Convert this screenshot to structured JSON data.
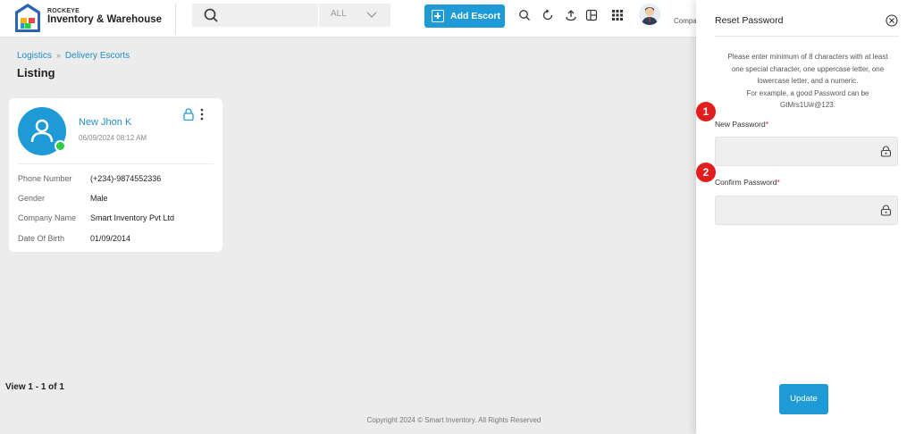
{
  "brand": {
    "small": "ROCKEYE",
    "name": "Inventory & Warehouse"
  },
  "search": {
    "placeholder": "",
    "filter_value": "ALL"
  },
  "header": {
    "add_button_label": "Add Escort",
    "company_text": "Compa"
  },
  "breadcrumb": {
    "items": [
      "Logistics",
      "Delivery Escorts"
    ]
  },
  "page": {
    "title": "Listing"
  },
  "card": {
    "name": "New Jhon K",
    "datetime": "06/09/2024 08:12 AM",
    "fields": [
      {
        "label": "Phone Number",
        "value": "(+234)-9874552336"
      },
      {
        "label": "Gender",
        "value": "Male"
      },
      {
        "label": "Company Name",
        "value": "Smart Inventory Pvt Ltd"
      },
      {
        "label": "Date Of Birth",
        "value": "01/09/2014"
      }
    ]
  },
  "pagination": {
    "view_text": "View 1 - 1 of 1"
  },
  "footer": {
    "text": "Copyright 2024 © Smart Inventory. All Rights Reserved"
  },
  "panel": {
    "title": "Reset Password",
    "hint_lines": [
      "Please enter minimum of 8 characters with at least",
      "one special character, one uppercase letter, one",
      "lowercase letter, and a numeric.",
      "For example, a good Password can be",
      "GtMrs1Ui#@123."
    ],
    "badges": [
      "1",
      "2"
    ],
    "new_password_label": "New Password",
    "confirm_password_label": "Confirm Password",
    "required_mark": "*",
    "new_password_value": "",
    "confirm_password_value": "",
    "update_label": "Update"
  },
  "colors": {
    "accent": "#1e9bd7",
    "badge": "#e31d1d",
    "online": "#2ecc40"
  },
  "icons": [
    "logo-icon",
    "search-icon",
    "chevron-down-icon",
    "plus-icon",
    "search-icon",
    "refresh-icon",
    "upload-icon",
    "layout-icon",
    "grid-icon",
    "avatar",
    "close-icon",
    "lock-icon",
    "kebab-icon",
    "user-icon"
  ]
}
